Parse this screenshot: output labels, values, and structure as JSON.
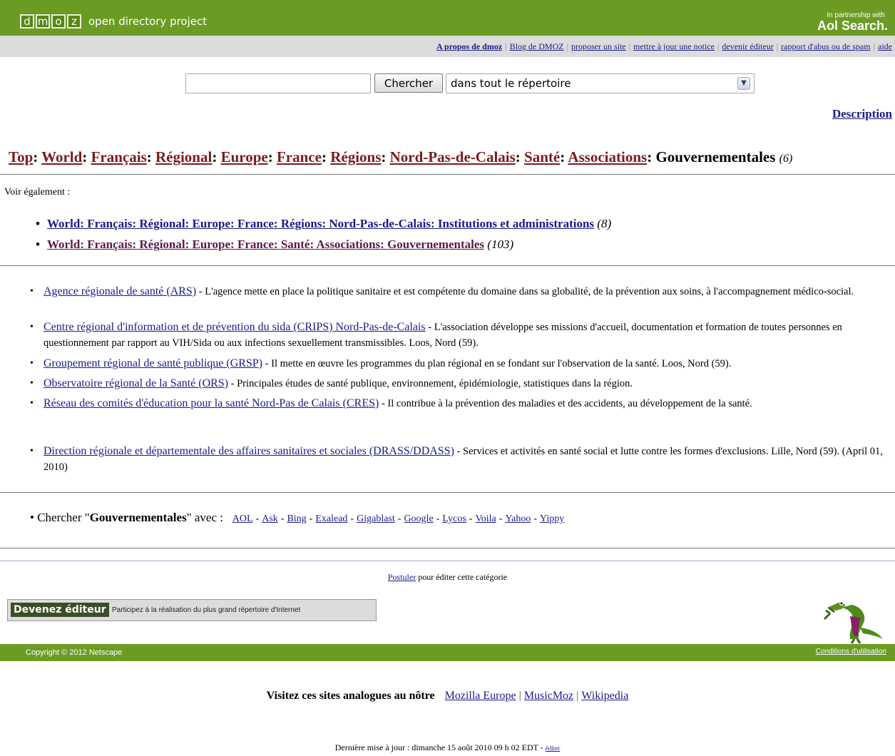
{
  "header": {
    "logo_letters": [
      "d",
      "m",
      "o",
      "z"
    ],
    "logo_text": "open directory project",
    "partner_small": "In partnership with",
    "partner_brand": "Aol Search."
  },
  "topnav": {
    "links": [
      "A propos de dmoz",
      "Blog de DMOZ",
      "proposer un site",
      "mettre à jour une notice",
      "devenir éditeur",
      "rapport d'abus ou de spam",
      "aide"
    ]
  },
  "search": {
    "input_value": "",
    "button_label": "Chercher",
    "scope_value": "dans tout le répertoire"
  },
  "description_link": "Description",
  "breadcrumb": {
    "items": [
      "Top",
      "World",
      "Français",
      "Régional",
      "Europe",
      "France",
      "Régions",
      "Nord-Pas-de-Calais",
      "Santé",
      "Associations"
    ],
    "current": "Gouvernementales",
    "count": "(6)"
  },
  "see_also": {
    "label": "Voir également :",
    "items": [
      {
        "text": "World: Français: Régional: Europe: France: Régions: Nord-Pas-de-Calais: Institutions et administrations",
        "count": "(8)"
      },
      {
        "text": "World: Français: Régional: Europe: France: Santé: Associations: Gouvernementales",
        "count": "(103)"
      }
    ]
  },
  "sites": [
    {
      "title": "Agence régionale de santé (ARS)",
      "desc": " - L'agence mette en place la politique sanitaire et est compétente du domaine dans sa globalité, de la prévention aux soins, à l'accompagnement médico-social."
    },
    {
      "title": "Centre régional d'information et de prévention du sida (CRIPS) Nord-Pas-de-Calais",
      "desc": " - L'association développe ses missions d'accueil, documentation et formation de toutes personnes en questionnement par rapport au VIH/Sida ou aux infections sexuellement transmissibles. Loos, Nord (59)."
    },
    {
      "title": "Groupement régional de santé publique (GRSP)",
      "desc": " - Il mette en œuvre les programmes du plan régional en se fondant sur l'observation de la santé. Loos, Nord (59)."
    },
    {
      "title": "Observatoire régional de la Santé (ORS)",
      "desc": " - Principales études de santé publique, environnement, épidémiologie, statistiques dans la région."
    },
    {
      "title": "Réseau des comités d'éducation pour la santé Nord-Pas de Calais (CRES)",
      "desc": " - Il contribue à la prévention des maladies et des accidents, au développement de la santé."
    },
    {
      "title": "Direction régionale et départementale des affaires sanitaires et sociales (DRASS/DDASS)",
      "desc": " - Services et activités en santé social et lutte contre les formes d'exclusions. Lille, Nord (59). (April 01, 2010)"
    }
  ],
  "search_with": {
    "prefix": "Chercher \"",
    "term": "Gouvernementales",
    "suffix": "\" avec :",
    "engines": [
      "AOL",
      "Ask",
      "Bing",
      "Exalead",
      "Gigablast",
      "Google",
      "Lycos",
      "Voila",
      "Yahoo",
      "Yippy"
    ]
  },
  "apply": {
    "link": "Postuler",
    "text": " pour éditer cette catégorie"
  },
  "become_editor": {
    "label": "Devenez éditeur",
    "text": "Participez à la réalisation du plus grand répertoire d'Internet"
  },
  "footer": {
    "copyright": "Copyright © 2012 Netscape",
    "conditions": "Conditions d'utilisation"
  },
  "sister_sites": {
    "label": "Visitez ces sites analogues au nôtre",
    "links": [
      "Mozilla Europe",
      "MusicMoz",
      "Wikipedia"
    ]
  },
  "last_update": {
    "text": "Dernière mise à jour : dimanche 15 août 2010 09 h 02 EDT - ",
    "edit_link": "éditer"
  },
  "colors": {
    "header_green": "#6c9b24",
    "nav_gray": "#dcdcdc",
    "link_blue": "#1a1a8c",
    "breadcrumb_link": "#7a1c1c"
  }
}
